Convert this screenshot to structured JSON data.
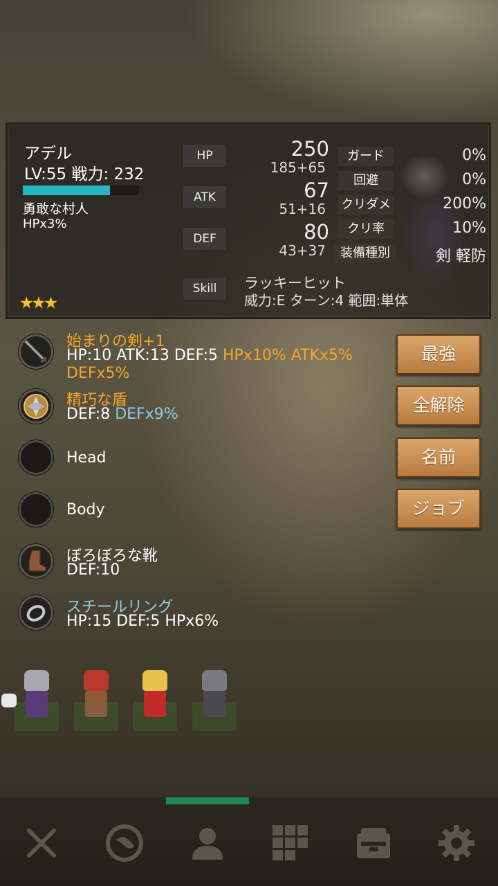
{
  "character": {
    "name": "アデル",
    "level_power": "LV:55 戦力: 232",
    "job": "勇敢な村人",
    "job_bonus": "HPx3%",
    "stars": "★★★",
    "hp_bar_fraction": 0.75
  },
  "stats": {
    "hp": {
      "label": "HP",
      "value": "250",
      "breakdown": "185+65"
    },
    "atk": {
      "label": "ATK",
      "value": "67",
      "breakdown": "51+16"
    },
    "def": {
      "label": "DEF",
      "value": "80",
      "breakdown": "43+37"
    },
    "skill": {
      "label": "Skill",
      "name": "ラッキーヒット",
      "desc": "威力:E ターン:4 範囲:単体"
    }
  },
  "right_stats": [
    {
      "label": "ガード",
      "value": "0%"
    },
    {
      "label": "回避",
      "value": "0%"
    },
    {
      "label": "クリダメ",
      "value": "200%"
    },
    {
      "label": "クリ率",
      "value": "10%"
    },
    {
      "label": "装備種別",
      "value": "剣 軽防"
    }
  ],
  "equipment": {
    "weapon": {
      "name": "始まりの剣+1",
      "stats": "HP:10 ATK:13 DEF:5",
      "bonus1": "HPx10% ATKx5%",
      "bonus2": "DEFx5%",
      "icon": "sword-icon"
    },
    "shield": {
      "name": "精巧な盾",
      "stats": "DEF:8",
      "bonus": "DEFx9%",
      "icon": "shield-icon"
    },
    "head": {
      "name": "Head"
    },
    "body": {
      "name": "Body"
    },
    "feet": {
      "name": "ぼろぼろな靴",
      "stats": "DEF:10",
      "icon": "boot-icon"
    },
    "ring": {
      "name": "スチールリング",
      "stats": "HP:15 DEF:5 HPx6%",
      "icon": "ring-icon"
    }
  },
  "buttons": {
    "strongest": "最強",
    "unequip_all": "全解除",
    "rename": "名前",
    "job": "ジョブ"
  },
  "colors": {
    "rarity_orange": "#f2a72b",
    "rarity_blue": "#92cbe6",
    "hp_bar": "#23b7c4",
    "button": "#c98e52",
    "tab_indicator": "#1f8a55"
  },
  "nav": [
    "battle-icon",
    "world-icon",
    "character-icon",
    "inventory-icon",
    "shop-icon",
    "settings-icon"
  ]
}
